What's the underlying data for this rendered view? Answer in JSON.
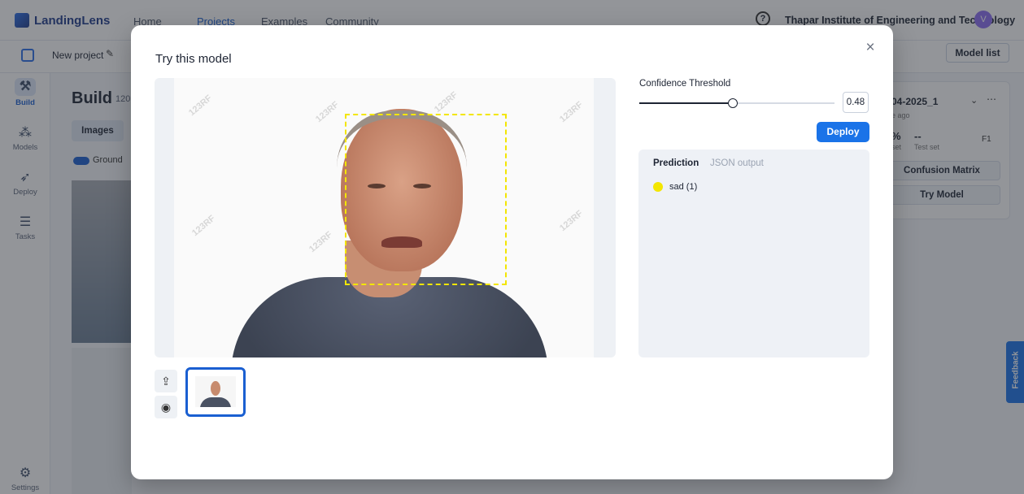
{
  "app": {
    "brand": "LandingLens",
    "nav": [
      "Home",
      "Projects",
      "Examples",
      "Community"
    ],
    "active_nav": "Projects",
    "help_glyph": "?",
    "org": "Thapar Institute of Engineering and Technology",
    "avatar_initial": "V"
  },
  "project": {
    "name": "New project",
    "model_list_label": "Model list"
  },
  "rail": [
    {
      "label": "Build",
      "icon": "tools-icon",
      "glyph": "⚒"
    },
    {
      "label": "Models",
      "icon": "models-icon",
      "glyph": "⁂"
    },
    {
      "label": "Deploy",
      "icon": "rocket-icon",
      "glyph": "➶"
    },
    {
      "label": "Tasks",
      "icon": "tasks-icon",
      "glyph": "☰"
    },
    {
      "label": "Settings",
      "icon": "gear-icon",
      "glyph": "⚙"
    }
  ],
  "background": {
    "build_title": "Build",
    "build_count": "120",
    "images_tab": "Images",
    "ground_truth": "Ground",
    "model_card_title": "04-2025_1",
    "model_card_ago": "e ago",
    "model_card_pct": "%",
    "model_card_dash": "--",
    "model_card_set": "set",
    "model_card_testset": "Test set",
    "model_card_f1": "F1",
    "confusion_matrix": "Confusion Matrix",
    "try_model": "Try Model",
    "feedback": "Feedback"
  },
  "modal": {
    "title": "Try this model",
    "close_glyph": "×",
    "confidence_label": "Confidence Threshold",
    "confidence_value": "0.48",
    "confidence_fraction": 0.48,
    "deploy_label": "Deploy",
    "tabs": [
      "Prediction",
      "JSON output"
    ],
    "active_tab": "Prediction",
    "predictions": [
      {
        "label": "sad (1)",
        "color": "#f3e600"
      }
    ],
    "watermark": "123RF",
    "upload_glyph": "⇪",
    "camera_glyph": "◉"
  },
  "colors": {
    "accent": "#1a73e8",
    "bbox": "#f3e600"
  }
}
